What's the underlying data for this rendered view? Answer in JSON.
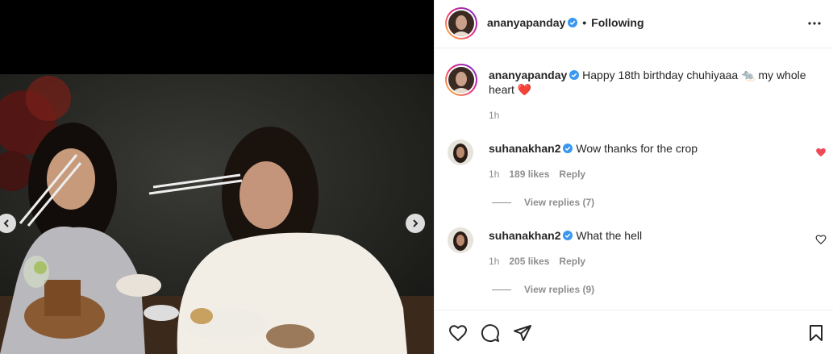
{
  "post": {
    "author": "ananyapanday",
    "follow_status": "Following",
    "separator": "•",
    "caption_text": "Happy 18th birthday chuhiyaaa 🐀 my whole heart",
    "caption_emoji_heart": "❤️",
    "caption_time": "1h"
  },
  "comments": [
    {
      "username": "suhanakhan2",
      "text": "Wow thanks for the crop",
      "time": "1h",
      "likes": "189 likes",
      "reply_label": "Reply",
      "view_replies": "View replies (7)",
      "liked": true
    },
    {
      "username": "suhanakhan2",
      "text": "What the hell",
      "time": "1h",
      "likes": "205 likes",
      "reply_label": "Reply",
      "view_replies": "View replies (9)",
      "liked": false
    }
  ],
  "colors": {
    "liked_heart": "#ed4956",
    "verified": "#3897f0",
    "muted": "#8e8e8e"
  },
  "icons": {
    "like": "heart-outline-icon",
    "comment": "comment-bubble-icon",
    "share": "paper-plane-icon",
    "save": "bookmark-icon",
    "more": "more-options-icon",
    "verified": "verified-badge-icon",
    "prev": "chevron-left-icon",
    "next": "chevron-right-icon"
  }
}
